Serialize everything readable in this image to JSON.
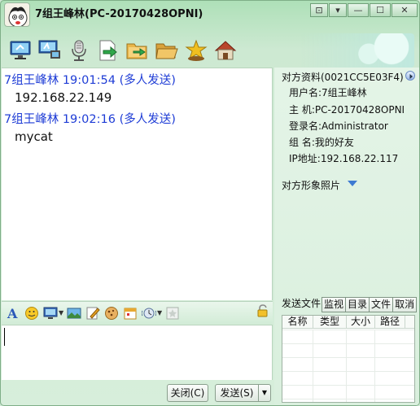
{
  "window": {
    "title": "7组王峰林(PC-20170428OPNI)",
    "controls": [
      "⊡",
      "▾",
      "—",
      "☐",
      "✕"
    ]
  },
  "toolbar": {
    "icons": [
      "monitor-icon",
      "remote-assist-icon",
      "microphone-icon",
      "send-file-icon",
      "send-folder-icon",
      "folder-open-icon",
      "star-person-icon",
      "home-icon"
    ]
  },
  "chat": {
    "messages": [
      {
        "header": "7组王峰林 19:01:54 (多人发送)",
        "body": "192.168.22.149"
      },
      {
        "header": "7组王峰林 19:02:16 (多人发送)",
        "body": "mycat"
      }
    ]
  },
  "input_toolbar": {
    "icons": [
      "font-icon",
      "smiley-icon",
      "screenshot-icon",
      "image-icon",
      "edit-icon",
      "cookie-icon",
      "calendar-icon",
      "shake-icon",
      "disabled-icon"
    ]
  },
  "buttons": {
    "close": "关闭(C)",
    "send": "发送(S)",
    "send_dropdown": "▼"
  },
  "info": {
    "title": "对方资料(0021CC5E03F4)",
    "username": "用户名:7组王峰林",
    "host": "主  机:PC-20170428OPNI",
    "login": "登录名:Administrator",
    "group": "组  名:我的好友",
    "ip": "IP地址:192.168.22.117",
    "photo_label": "对方形象照片"
  },
  "file_transfer": {
    "tabs": [
      "发送文件",
      "监视",
      "目录",
      "文件",
      "取消"
    ],
    "columns": [
      "名称",
      "类型",
      "大小",
      "路径"
    ]
  }
}
